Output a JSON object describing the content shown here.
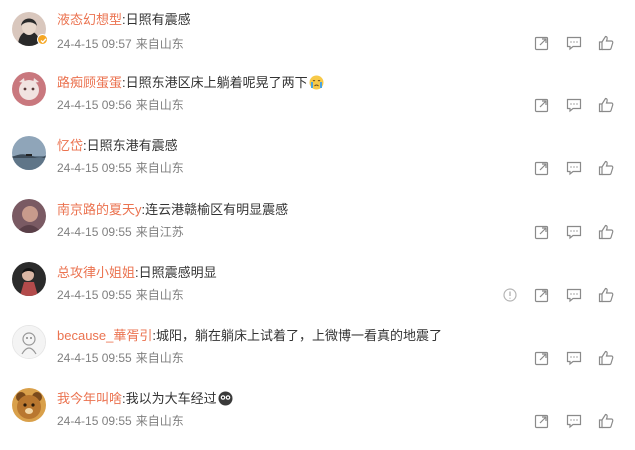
{
  "comments": [
    {
      "user": "液态幻想型",
      "text": "日照有震感",
      "time": "24-4-15 09:57",
      "source": "来自山东",
      "verified": true,
      "avatar": {
        "bg": "#d9c7bd",
        "fg": "#2a2a2a"
      }
    },
    {
      "user": "路痴顾蛋蛋",
      "text": "日照东港区床上躺着呢晃了两下",
      "time": "24-4-15 09:56",
      "source": "来自山东",
      "emoji": "crying-face-icon",
      "avatar": {
        "bg": "#c9787e",
        "fg": "#f1e3e1"
      }
    },
    {
      "user": "忆岱",
      "text": "日照东港有震感",
      "time": "24-4-15 09:55",
      "source": "来自山东",
      "avatar": {
        "bg": "#8fa5b9",
        "fg": "#3d4c5a"
      }
    },
    {
      "user": "南京路的夏天y",
      "text": "连云港赣榆区有明显震感",
      "time": "24-4-15 09:55",
      "source": "来自江苏",
      "avatar": {
        "bg": "#7a5a63",
        "fg": "#c89b8c"
      }
    },
    {
      "user": "总攻律小姐姐",
      "text": "日照震感明显",
      "time": "24-4-15 09:55",
      "source": "来自山东",
      "report": true,
      "avatar": {
        "bg": "#2b2b2b",
        "fg": "#b34b4b"
      }
    },
    {
      "user": "because_華胥引",
      "text": "城阳，躺在躺床上试着了，上微博一看真的地震了",
      "time": "24-4-15 09:55",
      "source": "来自山东",
      "avatar": {
        "bg": "#f4f4f4",
        "fg": "#999999"
      }
    },
    {
      "user": "我今年叫啥",
      "text": "我以为大车经过",
      "time": "24-4-15 09:55",
      "source": "来自山东",
      "emoji": "shocked-face-icon",
      "avatar": {
        "bg": "#d9a04a",
        "fg": "#7a4a1c"
      }
    }
  ],
  "colors": {
    "username": "#eb7350",
    "text": "#333333",
    "meta": "#808080",
    "icon": "#8a8a8a"
  }
}
